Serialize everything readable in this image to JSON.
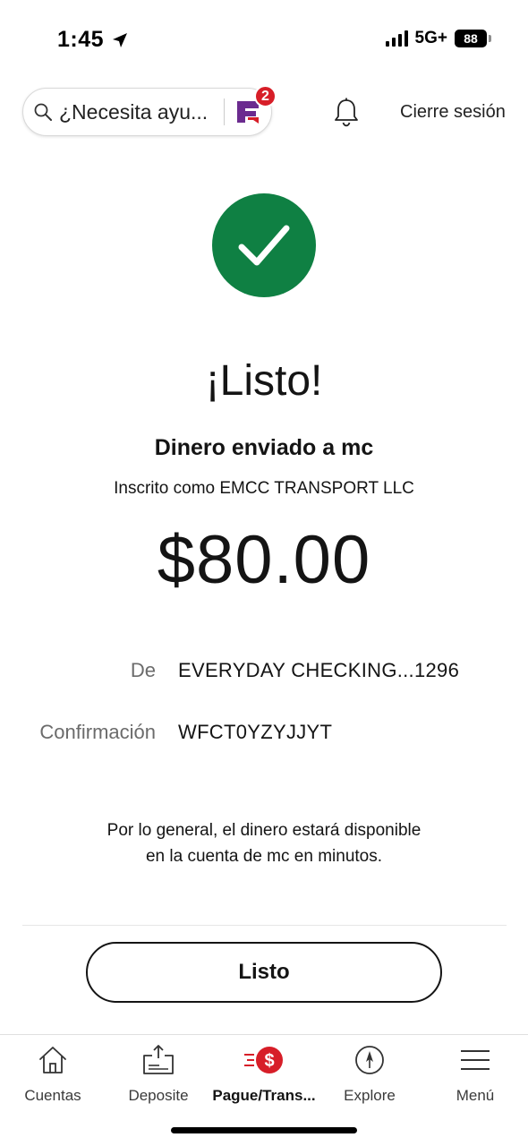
{
  "status_bar": {
    "time": "1:45",
    "network": "5G+",
    "battery": "88"
  },
  "header": {
    "search_placeholder": "¿Necesita ayu...",
    "assistant_badge": "2",
    "signout_label": "Cierre sesión"
  },
  "confirmation": {
    "title": "¡Listo!",
    "subtitle": "Dinero enviado a mc",
    "enrolled_as": "Inscrito como EMCC TRANSPORT LLC",
    "amount": "$80.00",
    "details": [
      {
        "label": "De",
        "value": "EVERYDAY CHECKING...1296"
      },
      {
        "label": "Confirmación",
        "value": "WFCT0YZYJJYT"
      }
    ],
    "info_line1": "Por lo general, el dinero estará disponible",
    "info_line2": "en la cuenta de mc en minutos.",
    "done_button": "Listo"
  },
  "bottom_nav": {
    "items": [
      {
        "label": "Cuentas",
        "icon": "house-icon"
      },
      {
        "label": "Deposite",
        "icon": "deposit-icon"
      },
      {
        "label": "Pague/Trans...",
        "icon": "pay-transfer-icon",
        "active": true
      },
      {
        "label": "Explore",
        "icon": "compass-icon"
      },
      {
        "label": "Menú",
        "icon": "hamburger-menu-icon"
      }
    ]
  },
  "colors": {
    "success_green": "#0f8043",
    "brand_red": "#d71e28",
    "assistant_purple": "#6b2b8f"
  }
}
